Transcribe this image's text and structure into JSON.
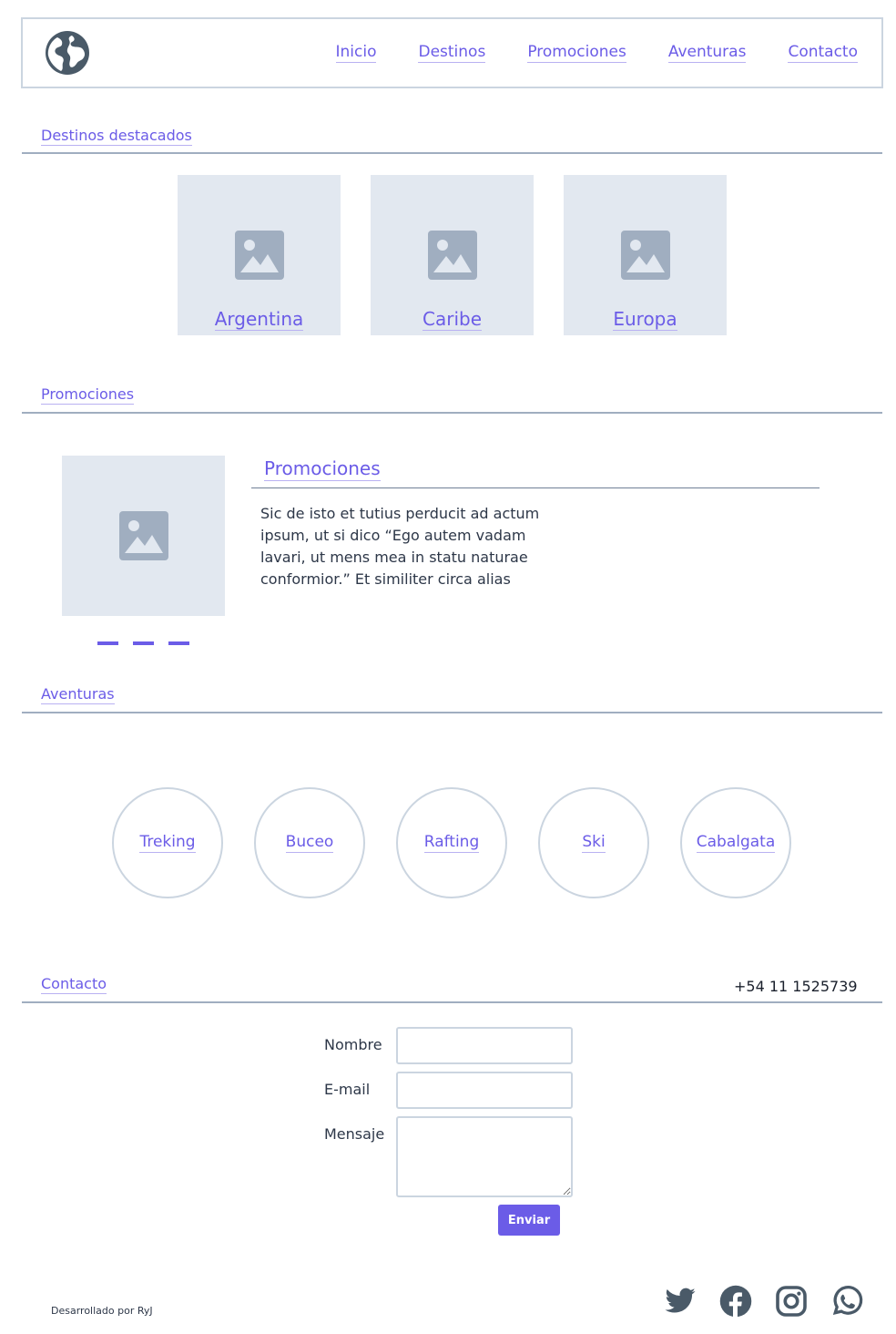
{
  "header": {
    "logo_icon": "globe-icon",
    "nav": [
      {
        "label": "Inicio"
      },
      {
        "label": "Destinos"
      },
      {
        "label": "Promociones"
      },
      {
        "label": "Aventuras"
      },
      {
        "label": "Contacto"
      }
    ]
  },
  "destinos": {
    "heading": "Destinos destacados",
    "cards": [
      {
        "label": "Argentina",
        "icon": "image-placeholder-icon"
      },
      {
        "label": "Caribe",
        "icon": "image-placeholder-icon"
      },
      {
        "label": "Europa",
        "icon": "image-placeholder-icon"
      }
    ]
  },
  "promociones": {
    "heading": "Promociones",
    "title": "Promociones",
    "text": "Sic de isto et tutius perducit ad actum ipsum, ut si dico “Ego autem vadam lavari, ut mens mea in statu naturae conformior.” Et similiter circa alias",
    "image_icon": "image-placeholder-icon",
    "carousel_dots": 3
  },
  "aventuras": {
    "heading": "Aventuras",
    "items": [
      {
        "label": "Treking"
      },
      {
        "label": "Buceo"
      },
      {
        "label": "Rafting"
      },
      {
        "label": "Ski"
      },
      {
        "label": "Cabalgata"
      }
    ]
  },
  "contacto": {
    "heading": "Contacto",
    "phone": "+54 11 1525739",
    "form": {
      "name_label": "Nombre",
      "name_value": "",
      "email_label": "E-mail",
      "email_value": "",
      "message_label": "Mensaje",
      "message_value": "",
      "submit_label": "Enviar"
    }
  },
  "footer": {
    "credit": "Desarrollado por RyJ",
    "social_icons": [
      "twitter-icon",
      "facebook-icon",
      "instagram-icon",
      "whatsapp-icon"
    ]
  },
  "colors": {
    "accent": "#6b5ce7",
    "border": "#cbd5e0",
    "placeholder_bg": "#e2e8f0",
    "icon_dark": "#4a5a68"
  }
}
